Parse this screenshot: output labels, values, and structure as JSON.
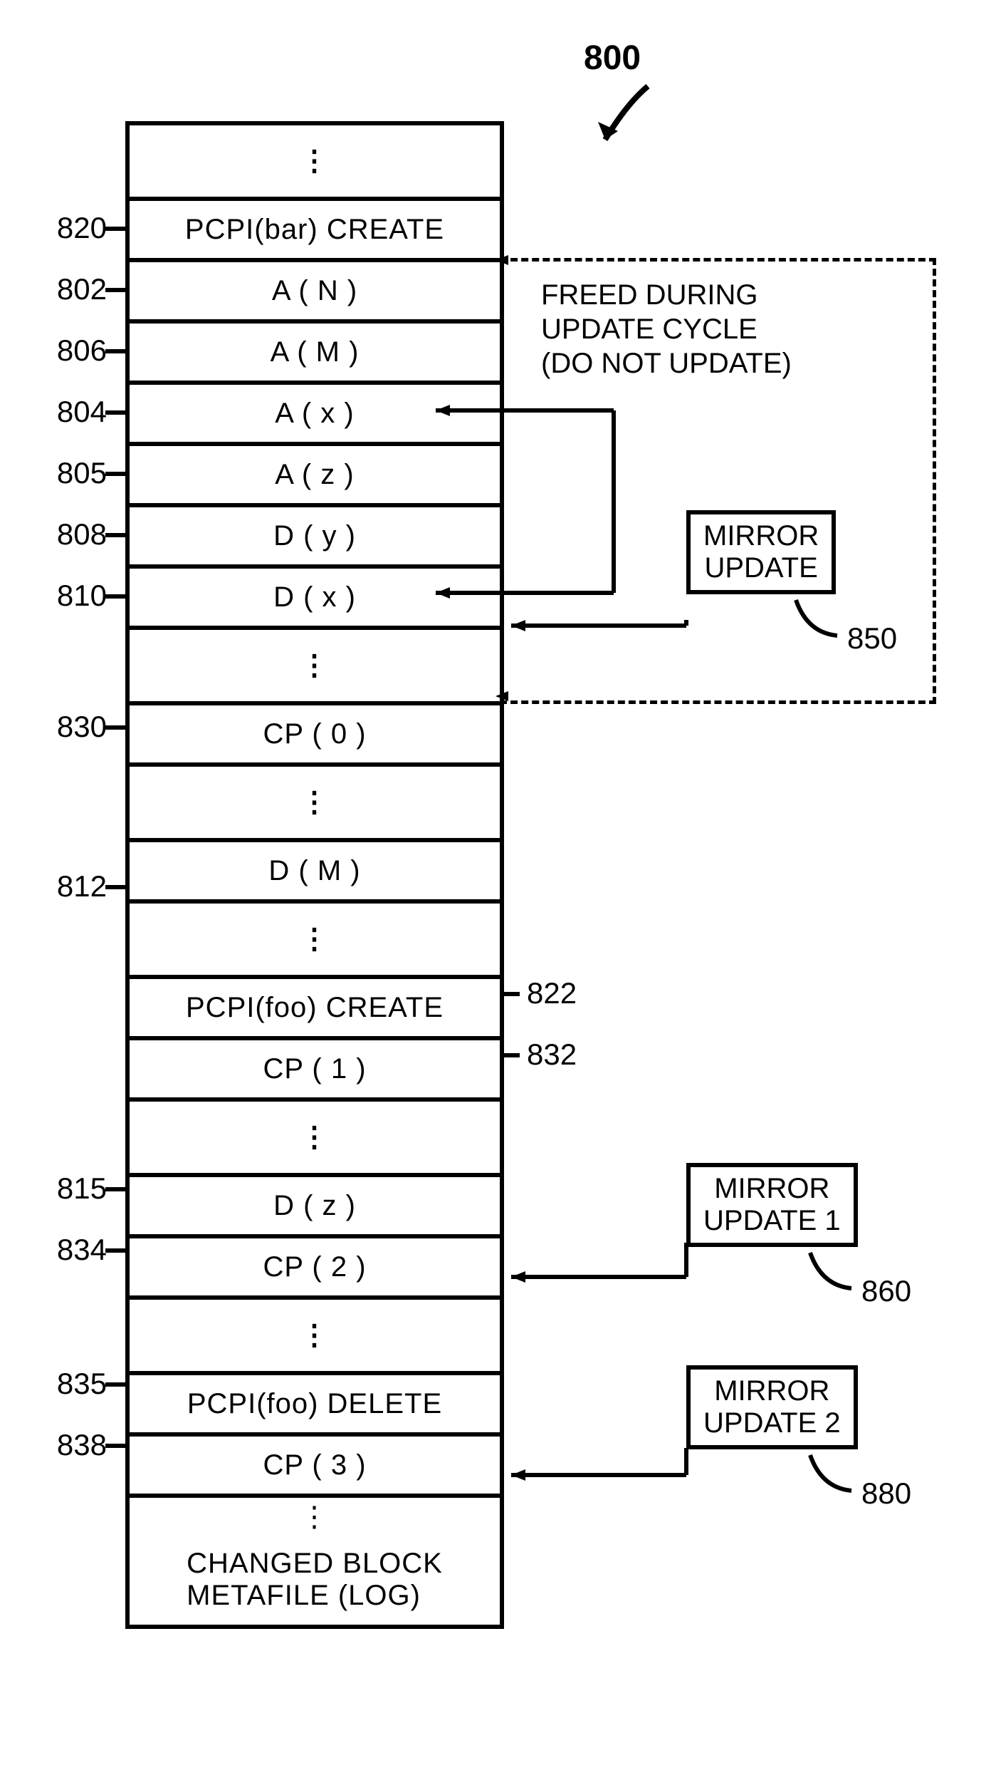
{
  "figure_number": "800",
  "table_title": "CHANGED BLOCK\nMETAFILE (LOG)",
  "rows": {
    "r1": "PCPI(bar) CREATE",
    "r2": "A ( N )",
    "r3": "A ( M )",
    "r4": "A ( x )",
    "r5": "A ( z )",
    "r6": "D ( y )",
    "r7": "D ( x )",
    "r8": "CP ( 0 )",
    "r9": "D ( M )",
    "r10": "PCPI(foo) CREATE",
    "r11": "CP ( 1 )",
    "r12": "D ( z )",
    "r13": "CP ( 2 )",
    "r14": "PCPI(foo) DELETE",
    "r15": "CP ( 3 )"
  },
  "left_labels": {
    "l820": "820",
    "l802": "802",
    "l806": "806",
    "l804": "804",
    "l805": "805",
    "l808": "808",
    "l810": "810",
    "l830": "830",
    "l812": "812",
    "l815": "815",
    "l834": "834",
    "l835": "835",
    "l838": "838"
  },
  "right_labels": {
    "r822": "822",
    "r832": "832",
    "r850": "850",
    "r860": "860",
    "r880": "880"
  },
  "annotation": "FREED DURING\nUPDATE CYCLE\n(DO NOT UPDATE)",
  "mirror_update": "MIRROR\nUPDATE",
  "mirror_update_1": "MIRROR\nUPDATE 1",
  "mirror_update_2": "MIRROR\nUPDATE 2"
}
